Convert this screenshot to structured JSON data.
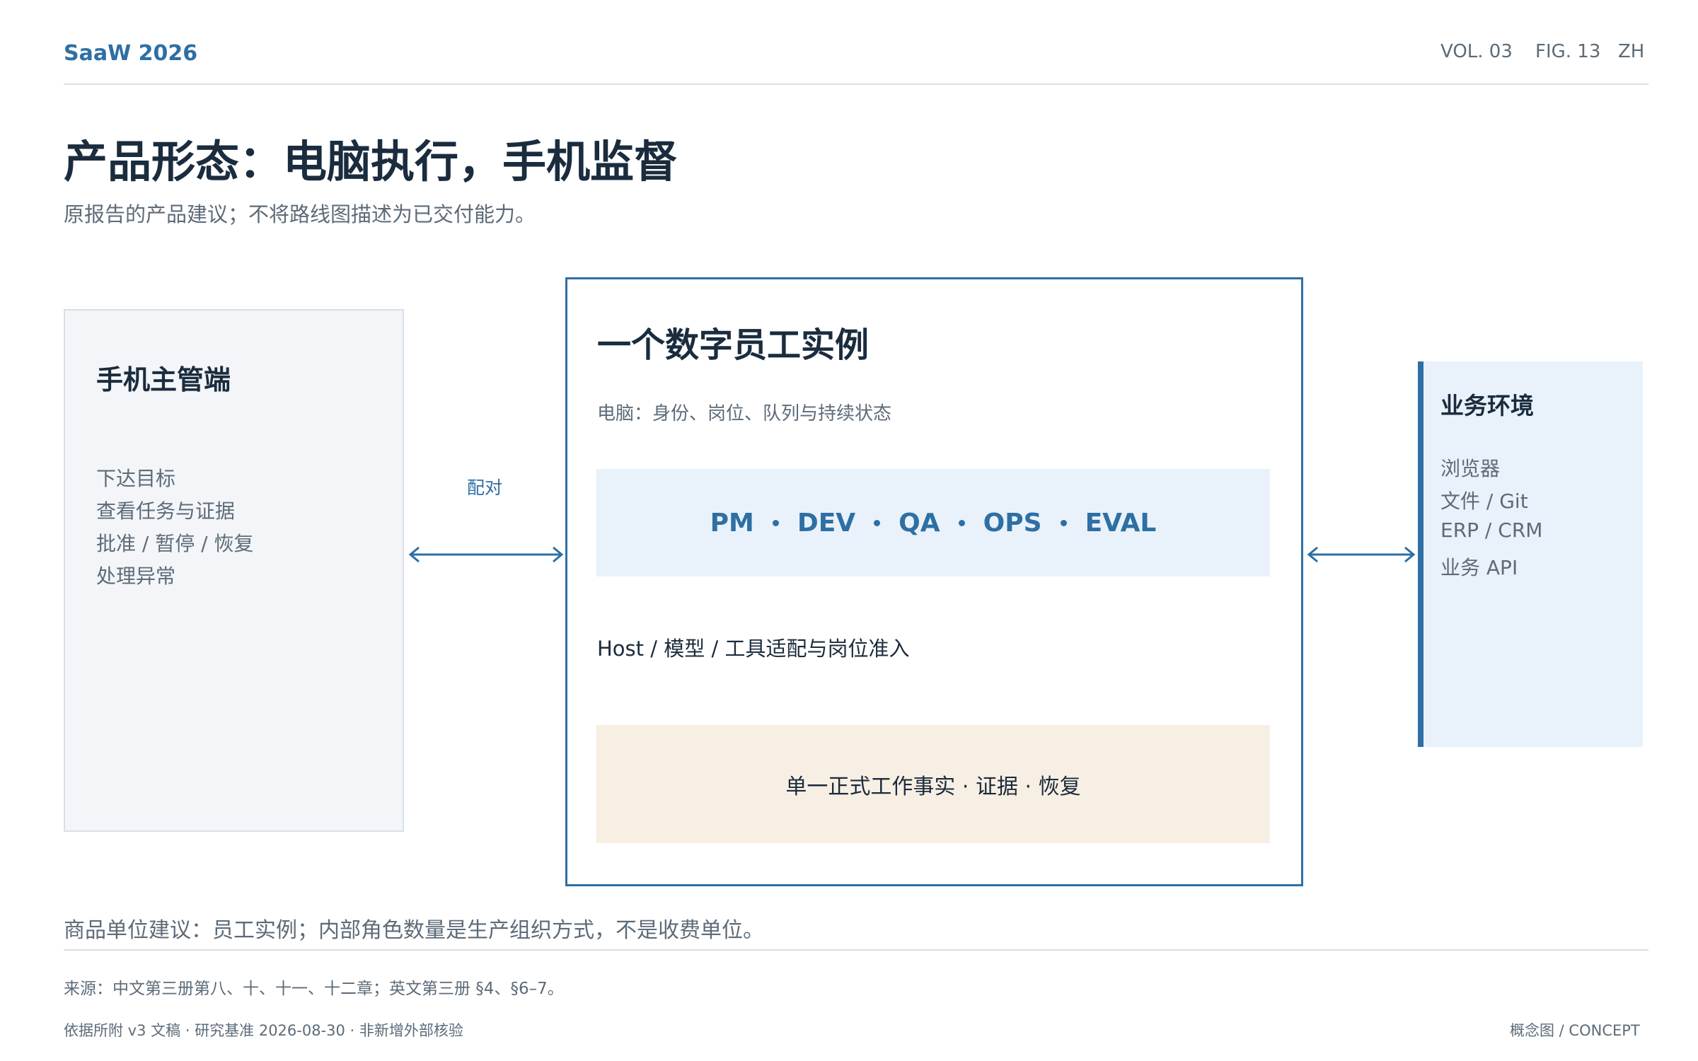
{
  "header": {
    "brand": "SaaW 2026",
    "volume": "VOL. 03",
    "figure": "FIG. 13",
    "language": "ZH"
  },
  "title": "产品形态：电脑执行，手机监督",
  "subtitle": "原报告的产品建议；不将路线图描述为已交付能力。",
  "left_panel": {
    "title": "手机主管端",
    "items": [
      "下达目标",
      "查看任务与证据",
      "批准 / 暂停 / 恢复",
      "处理异常"
    ]
  },
  "connector_left_label": "配对",
  "center": {
    "title": "一个数字员工实例",
    "subtitle": "电脑：身份、岗位、队列与持续状态",
    "roles": [
      "PM",
      "DEV",
      "QA",
      "OPS",
      "EVAL"
    ],
    "host_line": "Host / 模型 / 工具适配与岗位准入",
    "fact_line": "单一正式工作事实 · 证据 · 恢复"
  },
  "right_panel": {
    "title": "业务环境",
    "items": [
      "浏览器",
      "文件 / Git",
      "ERP / CRM",
      "业务 API"
    ]
  },
  "footnote": "商品单位建议：员工实例；内部角色数量是生产组织方式，不是收费单位。",
  "footer": {
    "source": "来源：中文第三册第八、十、十一、十二章；英文第三册 §4、§6–7。",
    "basis": "依据所附 v3 文稿 · 研究基准 2026-08-30 · 非新增外部核验",
    "concept": "概念图 / CONCEPT"
  },
  "colors": {
    "accent": "#2e6fa4",
    "heading": "#1a2c3e",
    "muted": "#5d6b78",
    "role_band": "#e9f2fa",
    "fact_band": "#f7efe4",
    "left_panel_bg": "#f3f5f8"
  }
}
